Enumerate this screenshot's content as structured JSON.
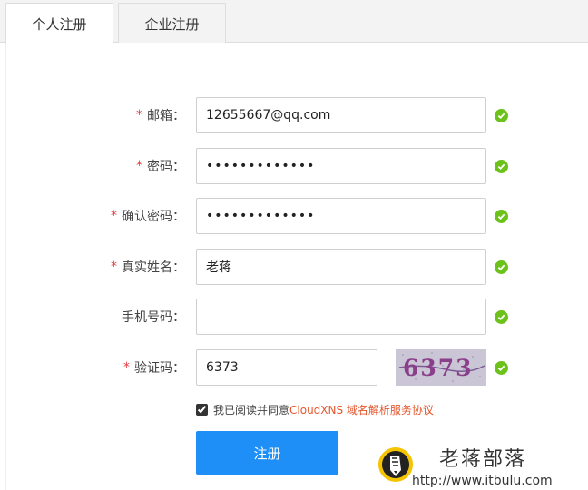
{
  "tabs": {
    "personal": "个人注册",
    "company": "企业注册"
  },
  "form": {
    "email": {
      "label": "邮箱：",
      "value": "12655667@qq.com",
      "required": true
    },
    "password": {
      "label": "密码：",
      "value": "passwordX1234",
      "required": true
    },
    "confirm_password": {
      "label": "确认密码：",
      "value": "passwordX1234",
      "required": true
    },
    "real_name": {
      "label": "真实姓名：",
      "value": "老蒋",
      "required": true
    },
    "phone": {
      "label": "手机号码：",
      "value": "",
      "required": false
    },
    "captcha": {
      "label": "验证码：",
      "value": "6373",
      "required": true,
      "image_text": "6373"
    }
  },
  "required_mark": "*",
  "agreement": {
    "text": "我已阅读并同意",
    "link": "CloudXNS 域名解析服务协议",
    "checked": true
  },
  "submit_label": "注册",
  "watermark": {
    "title": "老蒋部落",
    "url": "http://www.itbulu.com"
  },
  "colors": {
    "primary": "#1e8ff6",
    "success": "#6cc11a",
    "required": "#e4393c",
    "link": "#e4572e"
  },
  "icons": {
    "valid": "check-circle-icon",
    "logo": "pencil-logo-icon"
  }
}
